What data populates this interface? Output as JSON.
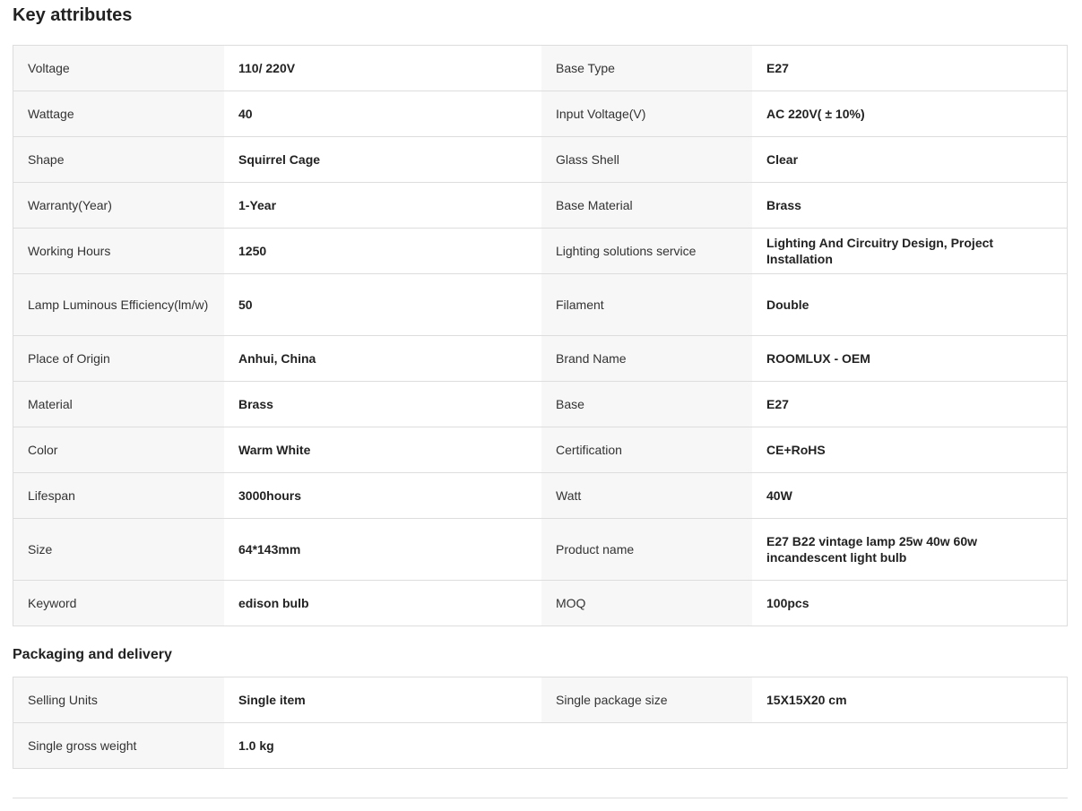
{
  "key_attributes": {
    "title": "Key attributes",
    "rows": [
      {
        "l1": "Voltage",
        "v1": "110/ 220V",
        "l2": "Base Type",
        "v2": "E27"
      },
      {
        "l1": "Wattage",
        "v1": "40",
        "l2": "Input Voltage(V)",
        "v2": "AC 220V( ± 10%)"
      },
      {
        "l1": "Shape",
        "v1": "Squirrel Cage",
        "l2": "Glass Shell",
        "v2": "Clear"
      },
      {
        "l1": "Warranty(Year)",
        "v1": "1-Year",
        "l2": "Base Material",
        "v2": "Brass"
      },
      {
        "l1": "Working Hours",
        "v1": "1250",
        "l2": "Lighting solutions service",
        "v2": "Lighting And Circuitry Design, Project Installation"
      },
      {
        "l1": "Lamp Luminous Efficiency(lm/w)",
        "v1": "50",
        "l2": "Filament",
        "v2": "Double"
      },
      {
        "l1": "Place of Origin",
        "v1": "Anhui, China",
        "l2": "Brand Name",
        "v2": "ROOMLUX - OEM"
      },
      {
        "l1": "Material",
        "v1": "Brass",
        "l2": "Base",
        "v2": "E27"
      },
      {
        "l1": "Color",
        "v1": "Warm White",
        "l2": "Certification",
        "v2": "CE+RoHS"
      },
      {
        "l1": "Lifespan",
        "v1": "3000hours",
        "l2": "Watt",
        "v2": "40W"
      },
      {
        "l1": "Size",
        "v1": "64*143mm",
        "l2": "Product name",
        "v2": "E27 B22 vintage lamp 25w 40w 60w incandescent light bulb"
      },
      {
        "l1": "Keyword",
        "v1": "edison bulb",
        "l2": "MOQ",
        "v2": "100pcs"
      }
    ]
  },
  "packaging": {
    "title": "Packaging and delivery",
    "rows": [
      {
        "l1": "Selling Units",
        "v1": "Single item",
        "l2": "Single package size",
        "v2": "15X15X20 cm"
      },
      {
        "l1": "Single gross weight",
        "v1": "1.0 kg"
      }
    ]
  },
  "colors": {
    "label_bg": "#f7f7f7",
    "border": "#dddddd",
    "text": "#222222"
  }
}
